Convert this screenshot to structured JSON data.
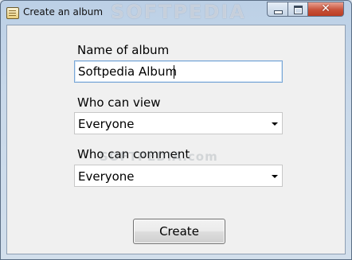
{
  "window": {
    "title": "Create an album",
    "watermark": "SOFTPEDIA",
    "controls": {
      "close_glyph": "✕"
    }
  },
  "form": {
    "name_label": "Name of album",
    "name_value": "Softpedia Album",
    "view_label": "Who can view",
    "view_value": "Everyone",
    "comment_label": "Who can comment",
    "comment_value": "Everyone",
    "ghost_watermark": "SOFTPEDIA.com",
    "create_label": "Create"
  },
  "icons": [
    "album-app-icon",
    "minimize-icon",
    "maximize-icon",
    "close-icon",
    "dropdown-arrow-icon"
  ]
}
